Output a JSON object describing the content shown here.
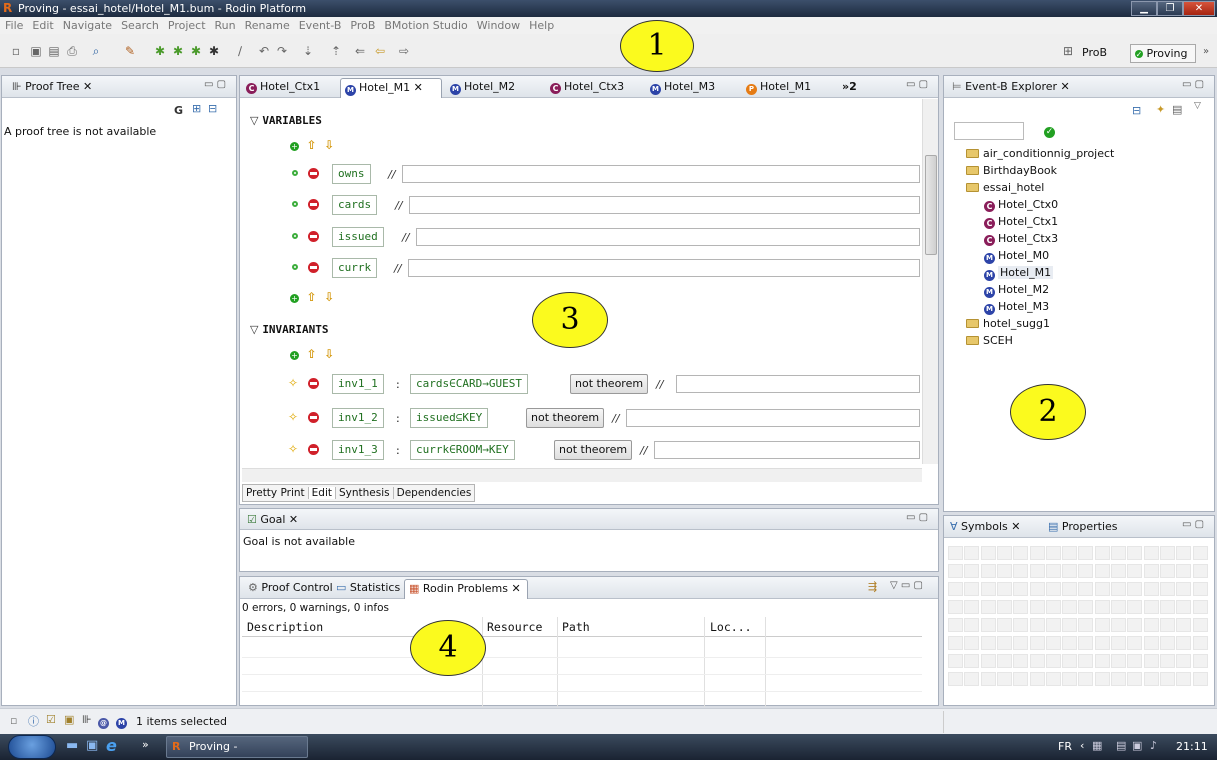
{
  "window": {
    "title": "Proving - essai_hotel/Hotel_M1.bum - Rodin Platform",
    "logo": "R"
  },
  "menu": [
    "File",
    "Edit",
    "Navigate",
    "Search",
    "Project",
    "Run",
    "Rename",
    "Event-B",
    "ProB",
    "BMotion Studio",
    "Window",
    "Help"
  ],
  "perspectives": {
    "prob": "ProB",
    "proving": "Proving"
  },
  "proof_tree": {
    "tab": "Proof Tree",
    "message": "A proof tree is not available",
    "g_label": "G"
  },
  "editor": {
    "tabs": [
      {
        "label": "Hotel_Ctx1",
        "kind": "c"
      },
      {
        "label": "Hotel_M1",
        "kind": "m"
      },
      {
        "label": "Hotel_M2",
        "kind": "m"
      },
      {
        "label": "Hotel_Ctx3",
        "kind": "c"
      },
      {
        "label": "Hotel_M3",
        "kind": "m"
      },
      {
        "label": "Hotel_M1",
        "kind": "p"
      }
    ],
    "overflow": "»2",
    "variables_header": "VARIABLES",
    "variables": [
      "owns",
      "cards",
      "issued",
      "currk"
    ],
    "invariants_header": "INVARIANTS",
    "invariants": [
      {
        "label": "inv1_1",
        "pred": "cards∈CARD→GUEST",
        "button": "not theorem"
      },
      {
        "label": "inv1_2",
        "pred": "issued⊆KEY",
        "button": "not theorem"
      },
      {
        "label": "inv1_3",
        "pred": "currk∈ROOM→KEY",
        "button": "not theorem"
      }
    ],
    "comment_sep": "//",
    "colon": ":",
    "bottom_tabs": [
      "Pretty Print",
      "Edit",
      "Synthesis",
      "Dependencies"
    ]
  },
  "explorer": {
    "tab": "Event-B Explorer",
    "projects": [
      {
        "label": "air_conditionnig_project",
        "level": 0,
        "icon": "folder"
      },
      {
        "label": "BirthdayBook",
        "level": 0,
        "icon": "folder"
      },
      {
        "label": "essai_hotel",
        "level": 0,
        "icon": "folder"
      },
      {
        "label": "Hotel_Ctx0",
        "level": 1,
        "icon": "c"
      },
      {
        "label": "Hotel_Ctx1",
        "level": 1,
        "icon": "c"
      },
      {
        "label": "Hotel_Ctx3",
        "level": 1,
        "icon": "c"
      },
      {
        "label": "Hotel_M0",
        "level": 1,
        "icon": "m"
      },
      {
        "label": "Hotel_M1",
        "level": 1,
        "icon": "m"
      },
      {
        "label": "Hotel_M2",
        "level": 1,
        "icon": "m"
      },
      {
        "label": "Hotel_M3",
        "level": 1,
        "icon": "m"
      },
      {
        "label": "hotel_sugg1",
        "level": 0,
        "icon": "folder"
      },
      {
        "label": "SCEH",
        "level": 0,
        "icon": "folder"
      }
    ]
  },
  "goal": {
    "tab": "Goal",
    "message": "Goal is not available"
  },
  "problems": {
    "tabs": [
      "Proof Control",
      "Statistics",
      "Rodin Problems"
    ],
    "summary": "0 errors, 0 warnings, 0 infos",
    "columns": [
      "Description",
      "Resource",
      "Path",
      "Loc..."
    ]
  },
  "symbols": {
    "tabs": [
      "Symbols",
      "Properties"
    ]
  },
  "status": {
    "text": "1 items selected"
  },
  "taskbar": {
    "app": "Proving - essai_hote...",
    "lang": "FR",
    "time": "21:11"
  },
  "annotations": [
    "1",
    "2",
    "3",
    "4"
  ],
  "colors": {
    "accent_blue": "#2d44a8",
    "context_purple": "#8a1e5a",
    "highlight_yellow": "#fbfa1e"
  }
}
